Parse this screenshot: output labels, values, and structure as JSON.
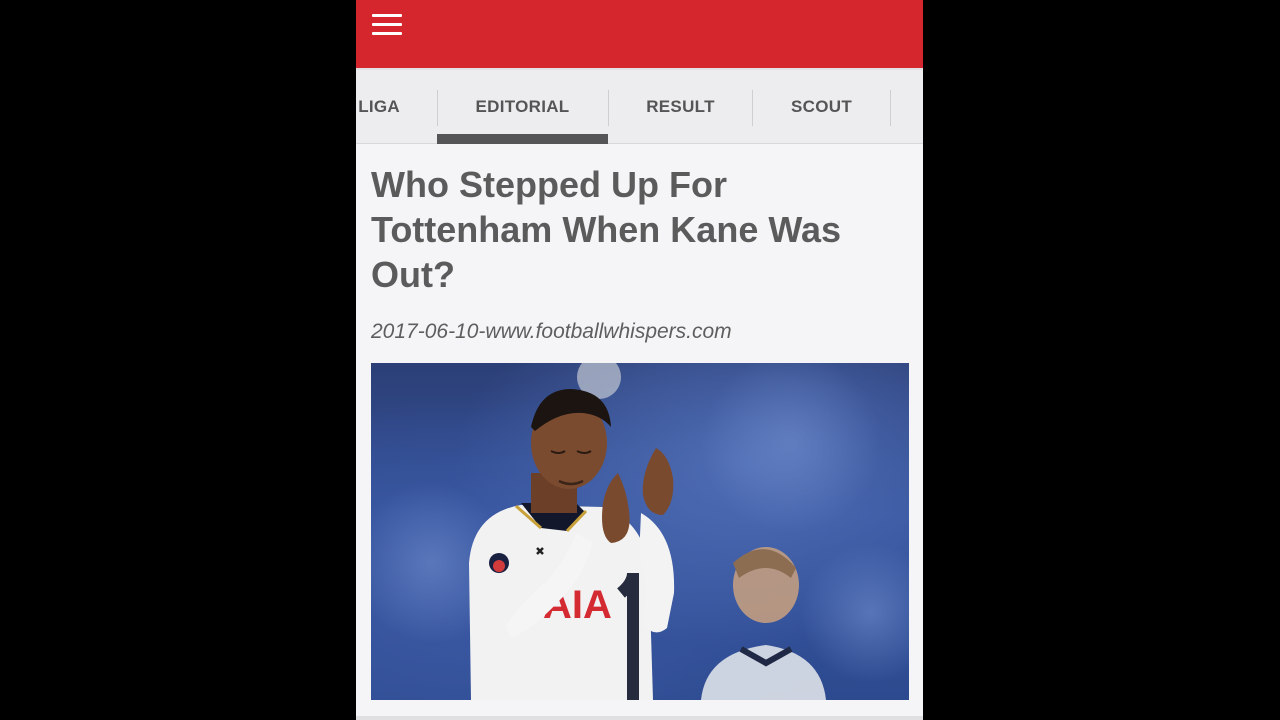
{
  "tabs": [
    {
      "label": "LIGA",
      "active": false
    },
    {
      "label": "EDITORIAL",
      "active": true
    },
    {
      "label": "RESULT",
      "active": false
    },
    {
      "label": "SCOUT",
      "active": false
    }
  ],
  "article": {
    "title": "Who Stepped Up For Tottenham When Kane Was Out?",
    "meta": "2017-06-10-www.footballwhispers.com"
  },
  "photo": {
    "jersey_text": "AIA"
  },
  "colors": {
    "appbar": "#d4262c",
    "tab_indicator": "#555558",
    "background": "#000000"
  }
}
